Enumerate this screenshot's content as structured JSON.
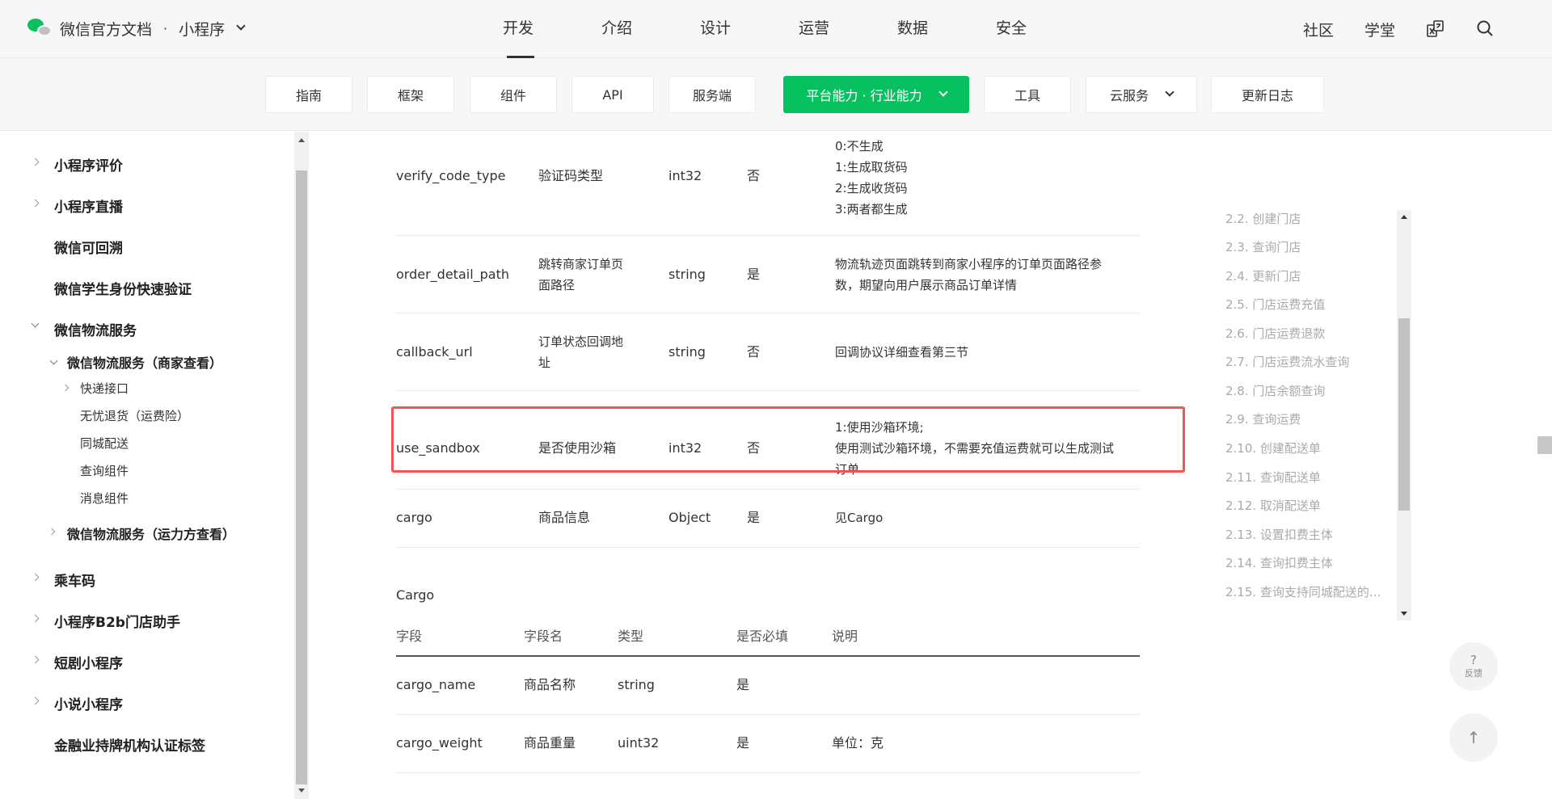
{
  "header": {
    "brand": "微信官方文档",
    "separator": "·",
    "product": "小程序",
    "nav": [
      "开发",
      "介绍",
      "设计",
      "运营",
      "数据",
      "安全"
    ],
    "active_nav": "开发",
    "right_links": [
      "社区",
      "学堂"
    ]
  },
  "subnav": {
    "tabs": [
      "指南",
      "框架",
      "组件",
      "API",
      "服务端",
      "平台能力 · 行业能力",
      "工具",
      "云服务",
      "更新日志"
    ],
    "active": "平台能力 · 行业能力",
    "accent": "#07c160"
  },
  "sidebar": {
    "items": [
      {
        "label": "小程序评价",
        "arrow": "right"
      },
      {
        "label": "小程序直播",
        "arrow": "right"
      },
      {
        "label": "微信可回溯",
        "arrow": "none"
      },
      {
        "label": "微信学生身份快速验证",
        "arrow": "none"
      },
      {
        "label": "微信物流服务",
        "arrow": "down"
      },
      {
        "label": "微信物流服务（商家查看）",
        "arrow": "down"
      },
      {
        "label": "快递接口",
        "arrow": "right"
      },
      {
        "label": "无忧退货（运费险）",
        "arrow": "none"
      },
      {
        "label": "同城配送",
        "arrow": "none"
      },
      {
        "label": "查询组件",
        "arrow": "none"
      },
      {
        "label": "消息组件",
        "arrow": "none"
      },
      {
        "label": "微信物流服务（运力方查看）",
        "arrow": "right"
      },
      {
        "label": "乘车码",
        "arrow": "right"
      },
      {
        "label": "小程序B2b门店助手",
        "arrow": "right"
      },
      {
        "label": "短剧小程序",
        "arrow": "right"
      },
      {
        "label": "小说小程序",
        "arrow": "right"
      },
      {
        "label": "金融业持牌机构认证标签",
        "arrow": "none"
      }
    ]
  },
  "params_table": {
    "rows": [
      {
        "field": "verify_code_type",
        "name": "验证码类型",
        "type": "int32",
        "required": "否",
        "desc": [
          "0:不生成",
          "1:生成取货码",
          "2:生成收货码",
          "3:两者都生成"
        ]
      },
      {
        "field": "order_detail_path",
        "name": [
          "跳转商家订单页",
          "面路径"
        ],
        "type": "string",
        "required": "是",
        "desc": [
          "物流轨迹页面跳转到商家小程序的订单页面路径参",
          "数，期望向用户展示商品订单详情"
        ]
      },
      {
        "field": "callback_url",
        "name": [
          "订单状态回调地",
          "址"
        ],
        "type": "string",
        "required": "否",
        "desc": [
          "回调协议详细查看第三节"
        ]
      },
      {
        "field": "use_sandbox",
        "name": "是否使用沙箱",
        "type": "int32",
        "required": "否",
        "desc": [
          "1:使用沙箱环境;",
          "使用测试沙箱环境，不需要充值运费就可以生成测试",
          "订单"
        ]
      },
      {
        "field": "cargo",
        "name": "商品信息",
        "type": "Object",
        "required": "是",
        "desc": [
          "见Cargo"
        ]
      }
    ],
    "highlight_color": "#f05454"
  },
  "cargo": {
    "title": "Cargo",
    "headers": [
      "字段",
      "字段名",
      "类型",
      "是否必填",
      "说明"
    ],
    "rows": [
      {
        "field": "cargo_name",
        "name": "商品名称",
        "type": "string",
        "required": "是",
        "desc": ""
      },
      {
        "field": "cargo_weight",
        "name": "商品重量",
        "type": "uint32",
        "required": "是",
        "desc": "单位：克"
      }
    ]
  },
  "toc": {
    "items": [
      "2.2. 创建门店",
      "2.3. 查询门店",
      "2.4. 更新门店",
      "2.5. 门店运费充值",
      "2.6. 门店运费退款",
      "2.7. 门店运费流水查询",
      "2.8. 门店余额查询",
      "2.9. 查询运费",
      "2.10. 创建配送单",
      "2.11. 查询配送单",
      "2.12. 取消配送单",
      "2.13. 设置扣费主体",
      "2.14. 查询扣费主体",
      "2.15. 查询支持同城配送的..."
    ]
  },
  "floating": {
    "feedback_symbol": "?",
    "feedback_label": "反馈",
    "top_symbol": "↑"
  }
}
